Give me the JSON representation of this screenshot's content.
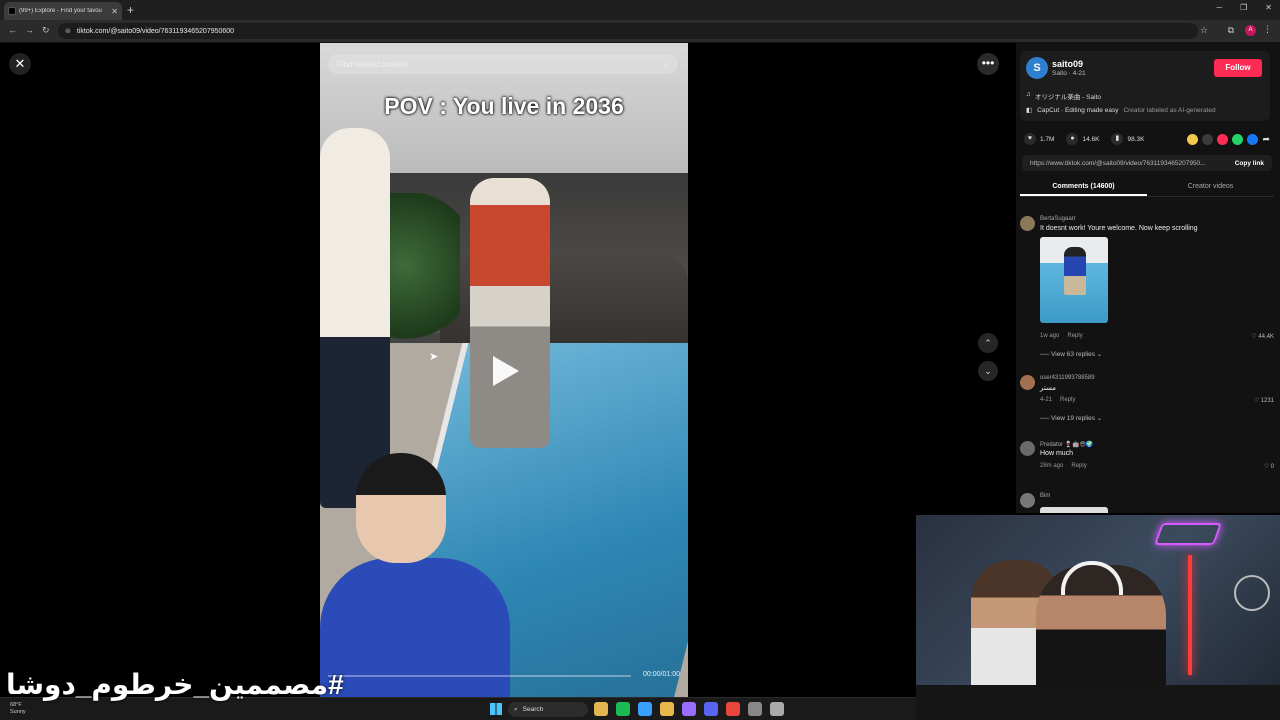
{
  "browser": {
    "tab_title": "(99+) Explore - Find your favou",
    "url": "tiktok.com/@saito09/video/7631193465207950600",
    "profile_initial": "A"
  },
  "video": {
    "search_placeholder": "Find related content",
    "overlay_title": "POV : You live in 2036",
    "time": "00:00/01:00",
    "progress": 0
  },
  "author": {
    "avatar_initial": "S",
    "name": "saito09",
    "subtitle": "Saito · 4-21",
    "follow_label": "Follow",
    "music": "オリジナル楽曲 - Saito",
    "capcut": "CapCut · Editing made easy",
    "ai_label": "Creator labeled as AI-generated"
  },
  "stats": {
    "likes": "1.7M",
    "comments": "14.6K",
    "saves": "98.3K"
  },
  "share_colors": [
    "#f2c94c",
    "#3a3a3a",
    "#fe2c55",
    "#25d366",
    "#1877f2"
  ],
  "link": {
    "url": "https://www.tiktok.com/@saito09/video/7631193465207950...",
    "copy_label": "Copy link"
  },
  "tabs": {
    "comments": "Comments (14600)",
    "creator_videos": "Creator videos"
  },
  "comments": [
    {
      "user": "BertaSugaarr",
      "text": "It doesnt work! Youre welcome. Now keep scrolling",
      "time": "1w ago",
      "reply": "Reply",
      "likes": "44.4K",
      "replies": "View 63 replies",
      "avatar_color": "#8a7a5a"
    },
    {
      "user": "user4311993788589",
      "text": "مستر",
      "time": "4-21",
      "reply": "Reply",
      "likes": "1231",
      "replies": "View 19 replies",
      "avatar_color": "#a07050"
    },
    {
      "user": "Predator 🍷🤖😎🌍",
      "text": "How much",
      "time": "28m ago",
      "reply": "Reply",
      "likes": "0",
      "avatar_color": "#6a6a6a"
    },
    {
      "user": "Bim",
      "avatar_color": "#777777"
    }
  ],
  "overlay_hashtag": "#مصممين_خرطوم_دوشا",
  "taskbar": {
    "weather_temp": "68°F",
    "weather_desc": "Sunny",
    "search_label": "Search",
    "icon_colors": [
      "#e0b84f",
      "#1db954",
      "#3aa0ff",
      "#e8b84a",
      "#9b6dff",
      "#5865f2",
      "#e8453c",
      "#888888",
      "#aaaaaa"
    ]
  }
}
